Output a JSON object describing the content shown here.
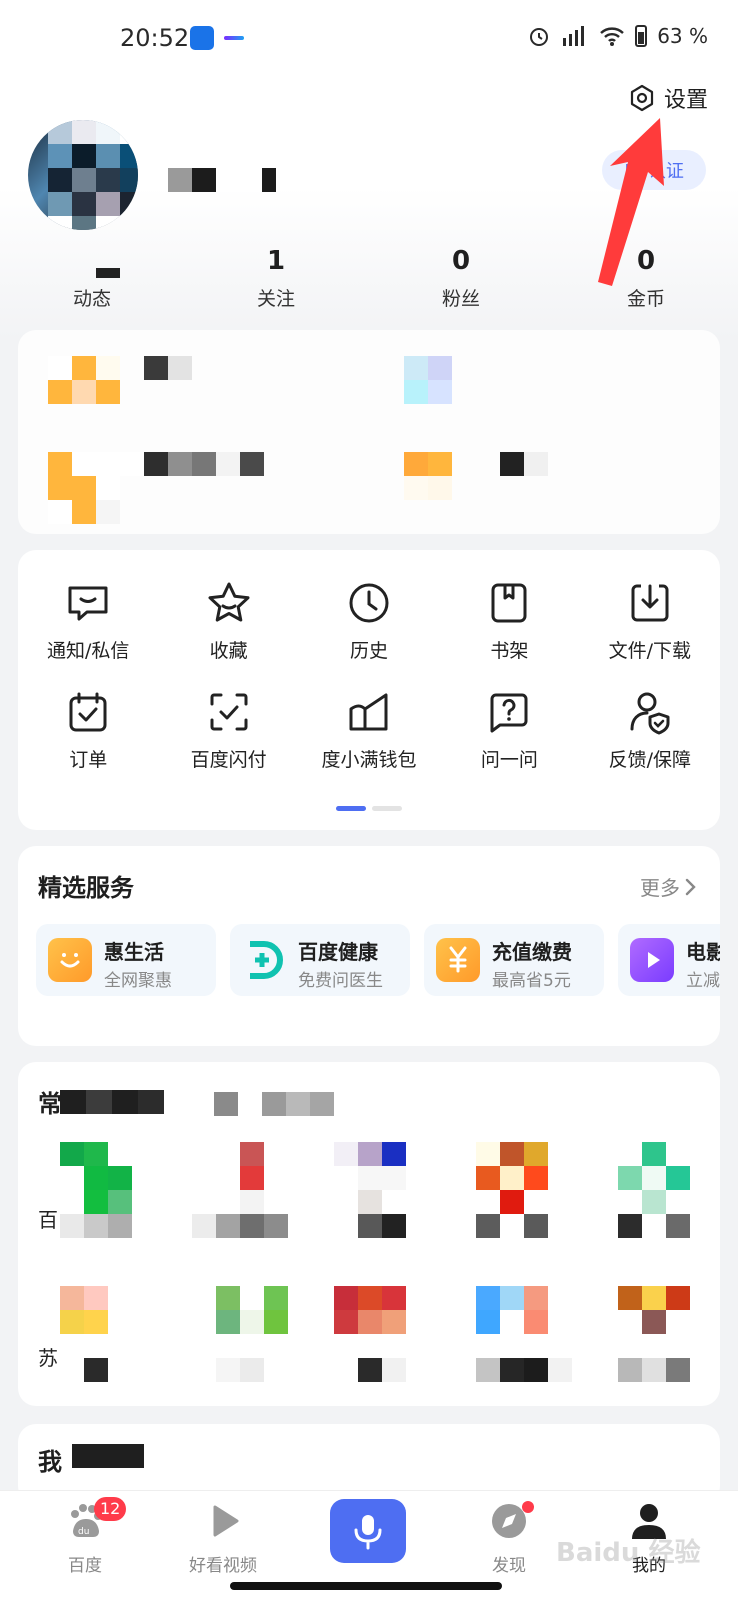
{
  "status_bar": {
    "time": "20:52",
    "battery": "63 %",
    "icons": [
      "app-notification-icon",
      "alarm-icon",
      "hd-signal-icon",
      "wifi-icon",
      "battery-icon"
    ]
  },
  "header": {
    "settings_label": "设置",
    "certify_label": "申 认证"
  },
  "stats": [
    {
      "num": "",
      "label": "动态"
    },
    {
      "num": "1",
      "label": "关注"
    },
    {
      "num": "0",
      "label": "粉丝"
    },
    {
      "num": "0",
      "label": "金币"
    }
  ],
  "tools": [
    {
      "label": "通知/私信",
      "icon": "message-icon"
    },
    {
      "label": "收藏",
      "icon": "star-icon"
    },
    {
      "label": "历史",
      "icon": "clock-icon"
    },
    {
      "label": "书架",
      "icon": "bookmark-icon"
    },
    {
      "label": "文件/下载",
      "icon": "download-icon"
    },
    {
      "label": "订单",
      "icon": "order-icon"
    },
    {
      "label": "百度闪付",
      "icon": "scan-pay-icon"
    },
    {
      "label": "度小满钱包",
      "icon": "wallet-icon"
    },
    {
      "label": "问一问",
      "icon": "question-icon"
    },
    {
      "label": "反馈/保障",
      "icon": "feedback-shield-icon"
    }
  ],
  "services": {
    "title": "精选服务",
    "more": "更多",
    "items": [
      {
        "title": "惠生活",
        "sub": "全网聚惠",
        "color": "#ffb938"
      },
      {
        "title": "百度健康",
        "sub": "免费问医生",
        "color": "#10c2b0"
      },
      {
        "title": "充值缴费",
        "sub": "最高省5元",
        "color": "#ffb938"
      },
      {
        "title": "电影",
        "sub": "立减",
        "color": "#8a4dff"
      }
    ]
  },
  "common_apps": {
    "title_prefix": "常",
    "row_labels": [
      "百",
      "苏"
    ]
  },
  "mine_section": {
    "title_prefix": "我"
  },
  "nav": {
    "items": [
      {
        "label": "百度",
        "badge": "12"
      },
      {
        "label": "好看视频"
      },
      {
        "label": ""
      },
      {
        "label": "发现"
      },
      {
        "label": "我的"
      }
    ]
  },
  "watermark": "Baidu 经验",
  "colors": {
    "accent": "#4e6ef2",
    "badge": "#ff3b4a",
    "annotation_arrow": "#ff3b3b"
  }
}
